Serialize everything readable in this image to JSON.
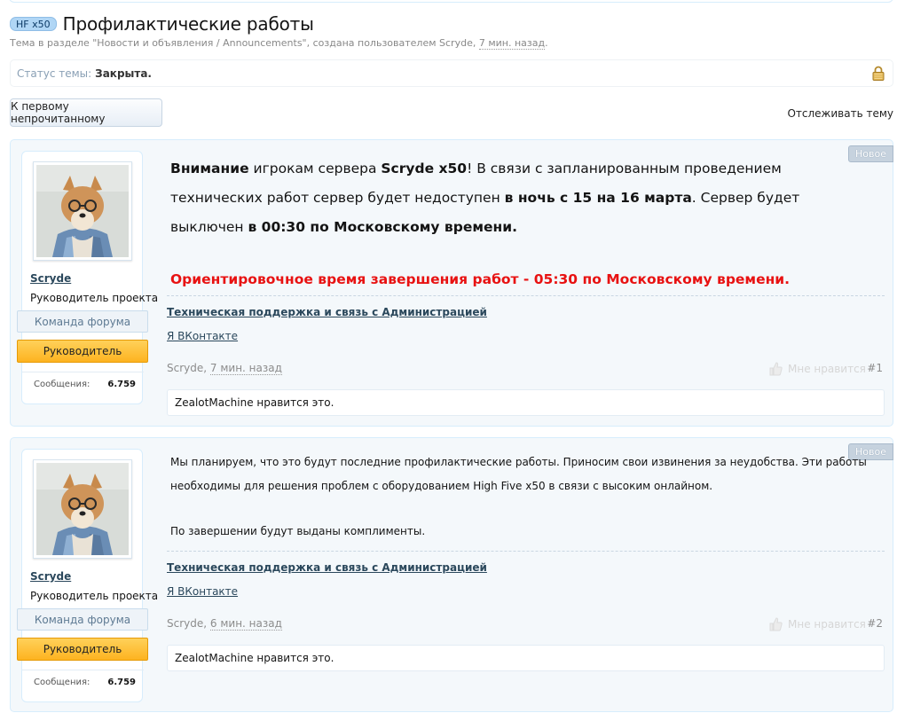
{
  "thread": {
    "prefix": "HF x50",
    "title": "Профилактические работы",
    "description_before": "Тема в разделе \"Новости и объявления / Announcements\", создана пользователем Scryde, ",
    "description_time": "7 мин. назад",
    "description_after": "."
  },
  "status": {
    "label": "Статус темы:",
    "value": "Закрыта.",
    "icon": "lock-icon"
  },
  "actions": {
    "first_unread": "К первому непрочитанному",
    "watch": "Отслеживать тему"
  },
  "colors": {
    "accent": "#2b485c",
    "red_notice": "#e81212",
    "leader_banner": "#fdb320"
  },
  "posts": [
    {
      "username": "Scryde",
      "user_title": "Руководитель проекта",
      "banner_team": "Команда форума",
      "banner_lead": "Руководитель",
      "stats_label": "Сообщения:",
      "stats_value": "6.759",
      "badge": "Новое",
      "message": {
        "p1_b1": "Внимание",
        "p1_t1": " игрокам сервера ",
        "p1_b2": "Scryde x50",
        "p1_t2": "! В связи с запланированным проведением технических работ сервер будет недоступен ",
        "p1_b3": "в ночь с 15 на 16 марта",
        "p1_t3": ". Сервер будет выключен ",
        "p1_b4": "в 00:30 по Московскому времени.",
        "p2_red": "Ориентировочное время завершения работ - 05:30 по Московскому времени."
      },
      "signature_link1": "Техническая поддержка и связь с Администрацией",
      "signature_link2": "Я ВКонтакте",
      "author": "Scryde",
      "time": "7 мин. назад",
      "like_label": "Мне нравится",
      "post_number": "#1",
      "likes_text": "ZealotMachine нравится это."
    },
    {
      "username": "Scryde",
      "user_title": "Руководитель проекта",
      "banner_team": "Команда форума",
      "banner_lead": "Руководитель",
      "stats_label": "Сообщения:",
      "stats_value": "6.759",
      "badge": "Новое",
      "message": {
        "line1": "Мы планируем, что это будут последние профилактические работы. Приносим свои извинения за неудобства. Эти работы",
        "line2": "необходимы для решения проблем с оборудованием High Five x50 в связи с высоким онлайном.",
        "line3": "По завершении будут выданы комплименты."
      },
      "signature_link1": "Техническая поддержка и связь с Администрацией",
      "signature_link2": "Я ВКонтакте",
      "author": "Scryde",
      "time": "6 мин. назад",
      "like_label": "Мне нравится",
      "post_number": "#2",
      "likes_text": "ZealotMachine нравится это."
    }
  ]
}
